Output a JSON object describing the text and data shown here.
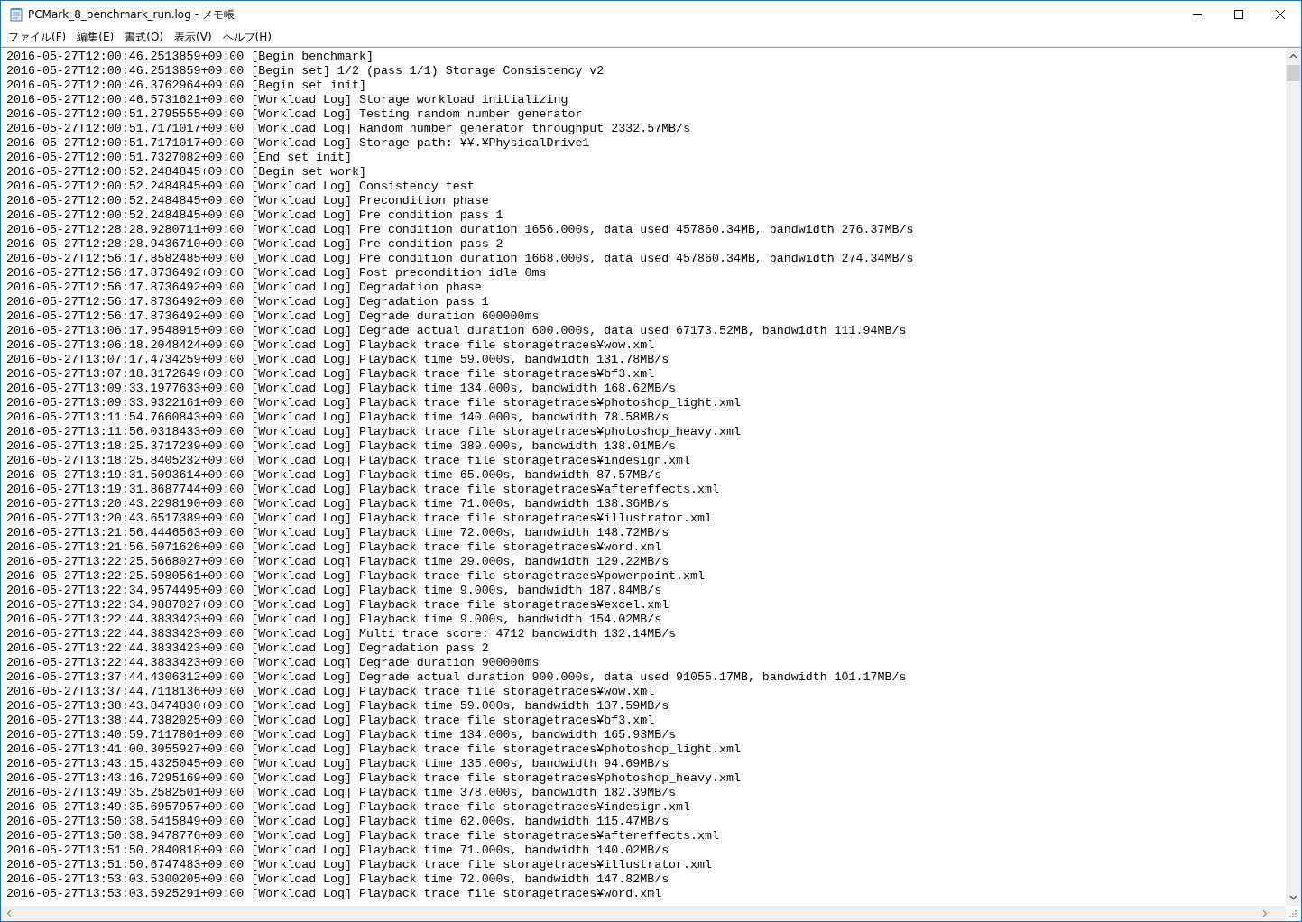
{
  "window": {
    "title": "PCMark_8_benchmark_run.log - メモ帳"
  },
  "menu": [
    "ファイル(F)",
    "編集(E)",
    "書式(O)",
    "表示(V)",
    "ヘルプ(H)"
  ],
  "lines": [
    "2016-05-27T12:00:46.2513859+09:00 [Begin benchmark]",
    "2016-05-27T12:00:46.2513859+09:00 [Begin set] 1/2 (pass 1/1) Storage Consistency v2",
    "2016-05-27T12:00:46.3762964+09:00 [Begin set init]",
    "2016-05-27T12:00:46.5731621+09:00 [Workload Log] Storage workload initializing",
    "2016-05-27T12:00:51.2795555+09:00 [Workload Log] Testing random number generator",
    "2016-05-27T12:00:51.7171017+09:00 [Workload Log] Random number generator throughput 2332.57MB/s",
    "2016-05-27T12:00:51.7171017+09:00 [Workload Log] Storage path: ¥¥.¥PhysicalDrive1",
    "2016-05-27T12:00:51.7327082+09:00 [End set init]",
    "2016-05-27T12:00:52.2484845+09:00 [Begin set work]",
    "2016-05-27T12:00:52.2484845+09:00 [Workload Log] Consistency test",
    "2016-05-27T12:00:52.2484845+09:00 [Workload Log] Precondition phase",
    "2016-05-27T12:00:52.2484845+09:00 [Workload Log] Pre condition pass 1",
    "2016-05-27T12:28:28.9280711+09:00 [Workload Log] Pre condition duration 1656.000s, data used 457860.34MB, bandwidth 276.37MB/s",
    "2016-05-27T12:28:28.9436710+09:00 [Workload Log] Pre condition pass 2",
    "2016-05-27T12:56:17.8582485+09:00 [Workload Log] Pre condition duration 1668.000s, data used 457860.34MB, bandwidth 274.34MB/s",
    "2016-05-27T12:56:17.8736492+09:00 [Workload Log] Post precondition idle 0ms",
    "2016-05-27T12:56:17.8736492+09:00 [Workload Log] Degradation phase",
    "2016-05-27T12:56:17.8736492+09:00 [Workload Log] Degradation pass 1",
    "2016-05-27T12:56:17.8736492+09:00 [Workload Log] Degrade duration 600000ms",
    "2016-05-27T13:06:17.9548915+09:00 [Workload Log] Degrade actual duration 600.000s, data used 67173.52MB, bandwidth 111.94MB/s",
    "2016-05-27T13:06:18.2048424+09:00 [Workload Log] Playback trace file storagetraces¥wow.xml",
    "2016-05-27T13:07:17.4734259+09:00 [Workload Log] Playback time 59.000s, bandwidth 131.78MB/s",
    "2016-05-27T13:07:18.3172649+09:00 [Workload Log] Playback trace file storagetraces¥bf3.xml",
    "2016-05-27T13:09:33.1977633+09:00 [Workload Log] Playback time 134.000s, bandwidth 168.62MB/s",
    "2016-05-27T13:09:33.9322161+09:00 [Workload Log] Playback trace file storagetraces¥photoshop_light.xml",
    "2016-05-27T13:11:54.7660843+09:00 [Workload Log] Playback time 140.000s, bandwidth 78.58MB/s",
    "2016-05-27T13:11:56.0318433+09:00 [Workload Log] Playback trace file storagetraces¥photoshop_heavy.xml",
    "2016-05-27T13:18:25.3717239+09:00 [Workload Log] Playback time 389.000s, bandwidth 138.01MB/s",
    "2016-05-27T13:18:25.8405232+09:00 [Workload Log] Playback trace file storagetraces¥indesign.xml",
    "2016-05-27T13:19:31.5093614+09:00 [Workload Log] Playback time 65.000s, bandwidth 87.57MB/s",
    "2016-05-27T13:19:31.8687744+09:00 [Workload Log] Playback trace file storagetraces¥aftereffects.xml",
    "2016-05-27T13:20:43.2298190+09:00 [Workload Log] Playback time 71.000s, bandwidth 138.36MB/s",
    "2016-05-27T13:20:43.6517389+09:00 [Workload Log] Playback trace file storagetraces¥illustrator.xml",
    "2016-05-27T13:21:56.4446563+09:00 [Workload Log] Playback time 72.000s, bandwidth 148.72MB/s",
    "2016-05-27T13:21:56.5071626+09:00 [Workload Log] Playback trace file storagetraces¥word.xml",
    "2016-05-27T13:22:25.5668027+09:00 [Workload Log] Playback time 29.000s, bandwidth 129.22MB/s",
    "2016-05-27T13:22:25.5980561+09:00 [Workload Log] Playback trace file storagetraces¥powerpoint.xml",
    "2016-05-27T13:22:34.9574495+09:00 [Workload Log] Playback time 9.000s, bandwidth 187.84MB/s",
    "2016-05-27T13:22:34.9887027+09:00 [Workload Log] Playback trace file storagetraces¥excel.xml",
    "2016-05-27T13:22:44.3833423+09:00 [Workload Log] Playback time 9.000s, bandwidth 154.02MB/s",
    "2016-05-27T13:22:44.3833423+09:00 [Workload Log] Multi trace score: 4712 bandwidth 132.14MB/s",
    "2016-05-27T13:22:44.3833423+09:00 [Workload Log] Degradation pass 2",
    "2016-05-27T13:22:44.3833423+09:00 [Workload Log] Degrade duration 900000ms",
    "2016-05-27T13:37:44.4306312+09:00 [Workload Log] Degrade actual duration 900.000s, data used 91055.17MB, bandwidth 101.17MB/s",
    "2016-05-27T13:37:44.7118136+09:00 [Workload Log] Playback trace file storagetraces¥wow.xml",
    "2016-05-27T13:38:43.8474830+09:00 [Workload Log] Playback time 59.000s, bandwidth 137.59MB/s",
    "2016-05-27T13:38:44.7382025+09:00 [Workload Log] Playback trace file storagetraces¥bf3.xml",
    "2016-05-27T13:40:59.7117801+09:00 [Workload Log] Playback time 134.000s, bandwidth 165.93MB/s",
    "2016-05-27T13:41:00.3055927+09:00 [Workload Log] Playback trace file storagetraces¥photoshop_light.xml",
    "2016-05-27T13:43:15.4325045+09:00 [Workload Log] Playback time 135.000s, bandwidth 94.69MB/s",
    "2016-05-27T13:43:16.7295169+09:00 [Workload Log] Playback trace file storagetraces¥photoshop_heavy.xml",
    "2016-05-27T13:49:35.2582501+09:00 [Workload Log] Playback time 378.000s, bandwidth 182.39MB/s",
    "2016-05-27T13:49:35.6957957+09:00 [Workload Log] Playback trace file storagetraces¥indesign.xml",
    "2016-05-27T13:50:38.5415849+09:00 [Workload Log] Playback time 62.000s, bandwidth 115.47MB/s",
    "2016-05-27T13:50:38.9478776+09:00 [Workload Log] Playback trace file storagetraces¥aftereffects.xml",
    "2016-05-27T13:51:50.2840818+09:00 [Workload Log] Playback time 71.000s, bandwidth 140.02MB/s",
    "2016-05-27T13:51:50.6747483+09:00 [Workload Log] Playback trace file storagetraces¥illustrator.xml",
    "2016-05-27T13:53:03.5300205+09:00 [Workload Log] Playback time 72.000s, bandwidth 147.82MB/s",
    "2016-05-27T13:53:03.5925291+09:00 [Workload Log] Playback trace file storagetraces¥word.xml"
  ]
}
